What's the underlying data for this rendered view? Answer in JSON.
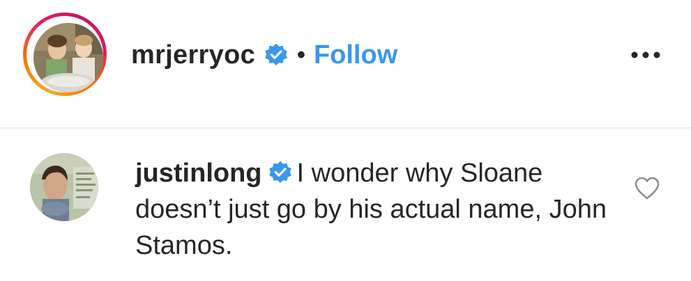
{
  "post_header": {
    "username": "mrjerryoc",
    "separator": "•",
    "follow_label": "Follow",
    "more_icon": "more-options-icon"
  },
  "comment": {
    "username": "justinlong",
    "text": "I wonder why Sloane doesn’t just go by his actual name, John Stamos.",
    "like_icon": "heart-outline-icon"
  },
  "colors": {
    "link_blue": "#3897f0",
    "verified_blue": "#3897f0",
    "text": "#262626",
    "divider": "#efefef"
  }
}
